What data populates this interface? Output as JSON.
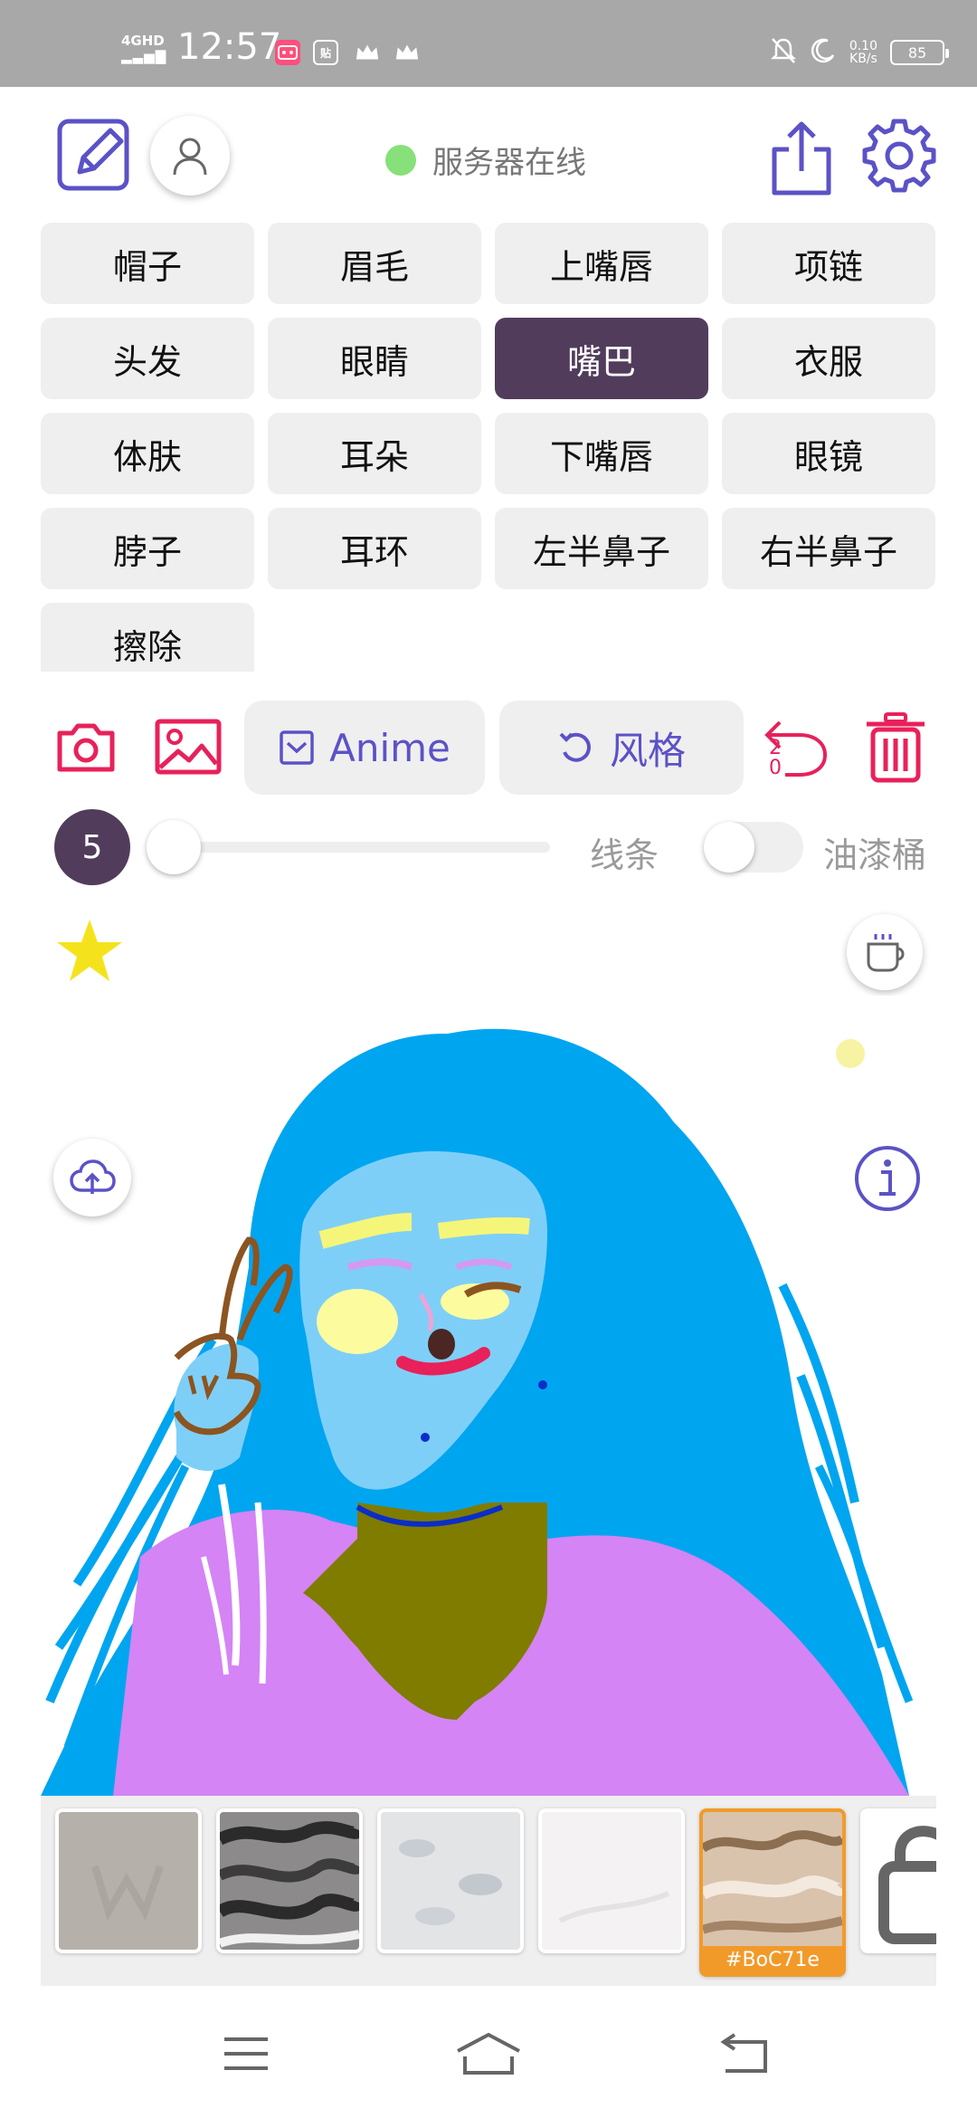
{
  "status_bar": {
    "network": "4GHD",
    "time": "12:57",
    "app_icon_2": "贴",
    "speed_value": "0.10",
    "speed_unit": "KB/s",
    "battery": "85"
  },
  "header": {
    "server_status": "服务器在线",
    "status_color": "#88e07a"
  },
  "parts": [
    "帽子",
    "眉毛",
    "上嘴唇",
    "项链",
    "头发",
    "眼睛",
    "嘴巴",
    "衣服",
    "体肤",
    "耳朵",
    "下嘴唇",
    "眼镜",
    "脖子",
    "耳环",
    "左半鼻子",
    "右半鼻子",
    "擦除"
  ],
  "selected_part": "嘴巴",
  "toolbar": {
    "anime_label": "Anime",
    "style_label": "风格",
    "undo_count": "20"
  },
  "brush": {
    "size": "5",
    "line_label": "线条",
    "bucket_label": "油漆桶"
  },
  "textures": {
    "selected_color_label": "#BoC71e"
  },
  "colors": {
    "accent": "#5b52c7",
    "danger": "#e8215a",
    "selected": "#523c5c",
    "orange": "#f19a2a"
  }
}
